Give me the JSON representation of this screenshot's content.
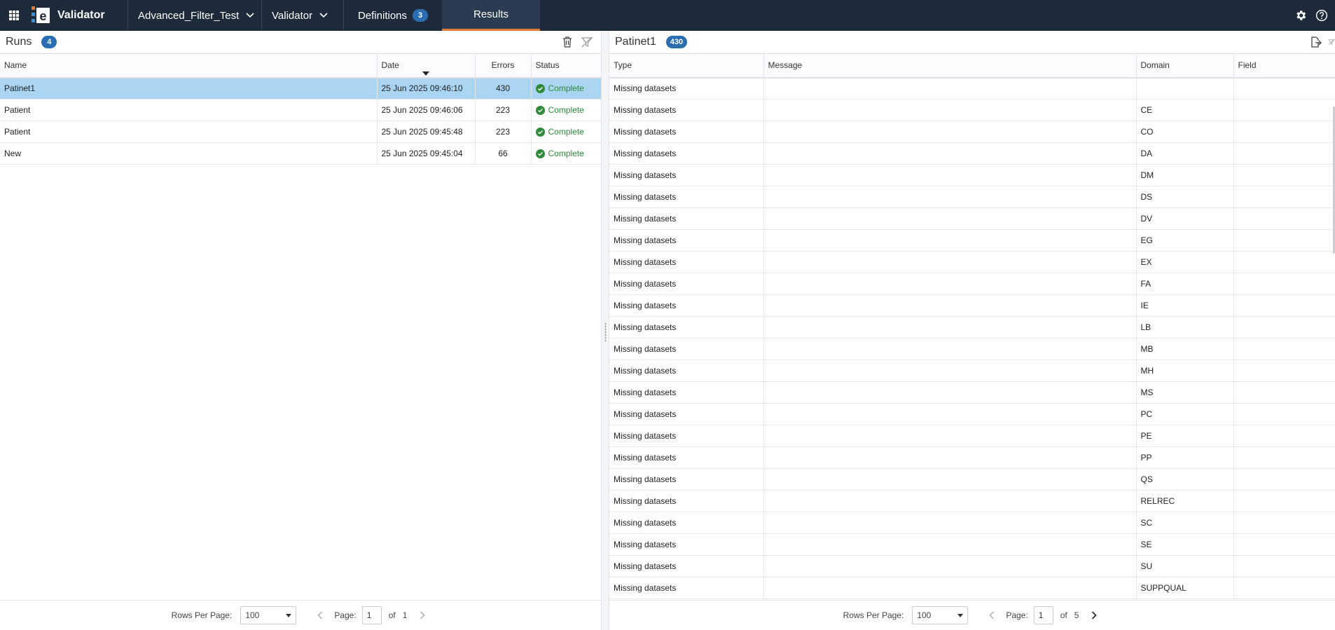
{
  "topbar": {
    "app_name": "Validator",
    "project": "Advanced_Filter_Test",
    "module": "Validator",
    "tabs": [
      {
        "label": "Definitions",
        "badge": "3"
      },
      {
        "label": "Results",
        "badge": ""
      }
    ],
    "icons": {
      "apps": "apps-grid-icon",
      "settings": "gear-icon",
      "help": "help-icon"
    },
    "colors": {
      "bar": "#1c2a3a",
      "active_tab_underline": "#e07a3a",
      "badge": "#2a6db0"
    }
  },
  "runs": {
    "title": "Runs",
    "count": "4",
    "columns": [
      "Name",
      "Date",
      "Errors",
      "Status"
    ],
    "rows": [
      {
        "name": "Patinet1",
        "date": "25 Jun 2025 09:46:10",
        "errors": "430",
        "status": "Complete",
        "selected": true
      },
      {
        "name": "Patient",
        "date": "25 Jun 2025 09:46:06",
        "errors": "223",
        "status": "Complete",
        "selected": false
      },
      {
        "name": "Patient",
        "date": "25 Jun 2025 09:45:48",
        "errors": "223",
        "status": "Complete",
        "selected": false
      },
      {
        "name": "New",
        "date": "25 Jun 2025 09:45:04",
        "errors": "66",
        "status": "Complete",
        "selected": false
      }
    ],
    "pager": {
      "rows_per_page_label": "Rows Per Page:",
      "rows_per_page": "100",
      "page_label": "Page:",
      "page": "1",
      "of_label": "of",
      "total_pages": "1"
    }
  },
  "results": {
    "title": "Patinet1",
    "count": "430",
    "columns": [
      "Type",
      "Message",
      "Domain",
      "Field"
    ],
    "rows": [
      {
        "type": "Missing datasets",
        "message": "",
        "domain": "",
        "field": ""
      },
      {
        "type": "Missing datasets",
        "message": "",
        "domain": "CE",
        "field": ""
      },
      {
        "type": "Missing datasets",
        "message": "",
        "domain": "CO",
        "field": ""
      },
      {
        "type": "Missing datasets",
        "message": "",
        "domain": "DA",
        "field": ""
      },
      {
        "type": "Missing datasets",
        "message": "",
        "domain": "DM",
        "field": ""
      },
      {
        "type": "Missing datasets",
        "message": "",
        "domain": "DS",
        "field": ""
      },
      {
        "type": "Missing datasets",
        "message": "",
        "domain": "DV",
        "field": ""
      },
      {
        "type": "Missing datasets",
        "message": "",
        "domain": "EG",
        "field": ""
      },
      {
        "type": "Missing datasets",
        "message": "",
        "domain": "EX",
        "field": ""
      },
      {
        "type": "Missing datasets",
        "message": "",
        "domain": "FA",
        "field": ""
      },
      {
        "type": "Missing datasets",
        "message": "",
        "domain": "IE",
        "field": ""
      },
      {
        "type": "Missing datasets",
        "message": "",
        "domain": "LB",
        "field": ""
      },
      {
        "type": "Missing datasets",
        "message": "",
        "domain": "MB",
        "field": ""
      },
      {
        "type": "Missing datasets",
        "message": "",
        "domain": "MH",
        "field": ""
      },
      {
        "type": "Missing datasets",
        "message": "",
        "domain": "MS",
        "field": ""
      },
      {
        "type": "Missing datasets",
        "message": "",
        "domain": "PC",
        "field": ""
      },
      {
        "type": "Missing datasets",
        "message": "",
        "domain": "PE",
        "field": ""
      },
      {
        "type": "Missing datasets",
        "message": "",
        "domain": "PP",
        "field": ""
      },
      {
        "type": "Missing datasets",
        "message": "",
        "domain": "QS",
        "field": ""
      },
      {
        "type": "Missing datasets",
        "message": "",
        "domain": "RELREC",
        "field": ""
      },
      {
        "type": "Missing datasets",
        "message": "",
        "domain": "SC",
        "field": ""
      },
      {
        "type": "Missing datasets",
        "message": "",
        "domain": "SE",
        "field": ""
      },
      {
        "type": "Missing datasets",
        "message": "",
        "domain": "SU",
        "field": ""
      },
      {
        "type": "Missing datasets",
        "message": "",
        "domain": "SUPPQUAL",
        "field": ""
      }
    ],
    "pager": {
      "rows_per_page_label": "Rows Per Page:",
      "rows_per_page": "100",
      "page_label": "Page:",
      "page": "1",
      "of_label": "of",
      "total_pages": "5"
    }
  }
}
